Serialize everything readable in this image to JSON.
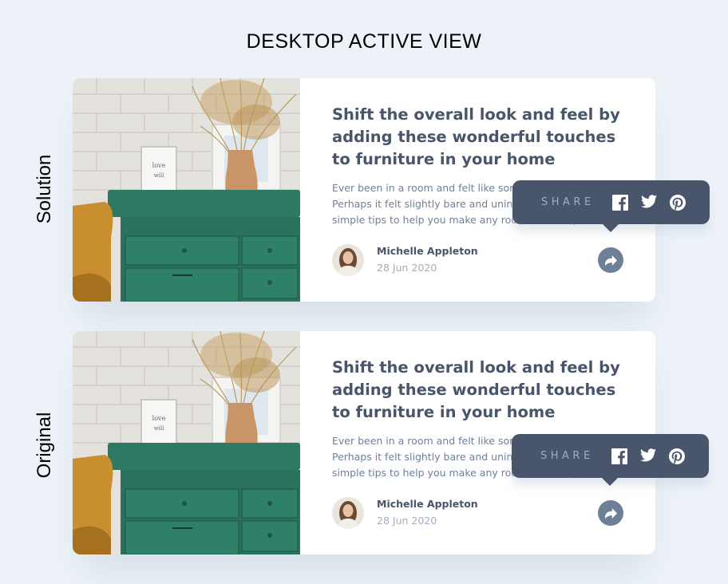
{
  "page": {
    "title": "DESKTOP ACTIVE VIEW"
  },
  "rows": [
    {
      "label": "Solution"
    },
    {
      "label": "Original"
    }
  ],
  "card": {
    "headline": "Shift the overall look and feel by adding these wonderful touches to furniture in your home",
    "excerpt": "Ever been in a room and felt like something was missing? Perhaps it felt slightly bare and uninviting. I’ve got some simple tips to help you make any room feel complete.",
    "author": {
      "name": "Michelle Appleton",
      "date": "28 Jun 2020"
    }
  },
  "share": {
    "label": "SHARE",
    "networks": [
      {
        "icon": "facebook-icon"
      },
      {
        "icon": "twitter-icon"
      },
      {
        "icon": "pinterest-icon"
      }
    ]
  },
  "colors": {
    "background": "#ecf2f8",
    "dark_grayish_blue": "#48556a",
    "desaturated_dark_blue": "#6e8098",
    "grayish_blue": "#9eafc2",
    "white": "#ffffff"
  }
}
